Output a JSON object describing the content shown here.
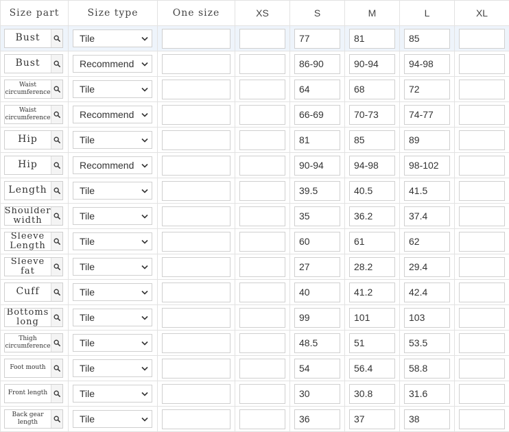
{
  "headers": {
    "part": "Size part",
    "type": "Size type",
    "one": "One size",
    "xs": "XS",
    "s": "S",
    "m": "M",
    "l": "L",
    "xl": "XL"
  },
  "rows": [
    {
      "part": "Bust",
      "type": "Tile",
      "one": "",
      "xs": "",
      "s": "77",
      "m": "81",
      "l": "85",
      "xl": ""
    },
    {
      "part": "Bust",
      "type": "Recommend",
      "one": "",
      "xs": "",
      "s": "86-90",
      "m": "90-94",
      "l": "94-98",
      "xl": ""
    },
    {
      "part": "Waist circumference",
      "type": "Tile",
      "one": "",
      "xs": "",
      "s": "64",
      "m": "68",
      "l": "72",
      "xl": ""
    },
    {
      "part": "Waist circumference",
      "type": "Recommend",
      "one": "",
      "xs": "",
      "s": "66-69",
      "m": "70-73",
      "l": "74-77",
      "xl": ""
    },
    {
      "part": "Hip",
      "type": "Tile",
      "one": "",
      "xs": "",
      "s": "81",
      "m": "85",
      "l": "89",
      "xl": ""
    },
    {
      "part": "Hip",
      "type": "Recommend",
      "one": "",
      "xs": "",
      "s": "90-94",
      "m": "94-98",
      "l": "98-102",
      "xl": ""
    },
    {
      "part": "Length",
      "type": "Tile",
      "one": "",
      "xs": "",
      "s": "39.5",
      "m": "40.5",
      "l": "41.5",
      "xl": ""
    },
    {
      "part": "Shoulder width",
      "type": "Tile",
      "one": "",
      "xs": "",
      "s": "35",
      "m": "36.2",
      "l": "37.4",
      "xl": ""
    },
    {
      "part": "Sleeve Length",
      "type": "Tile",
      "one": "",
      "xs": "",
      "s": "60",
      "m": "61",
      "l": "62",
      "xl": ""
    },
    {
      "part": "Sleeve fat",
      "type": "Tile",
      "one": "",
      "xs": "",
      "s": "27",
      "m": "28.2",
      "l": "29.4",
      "xl": ""
    },
    {
      "part": "Cuff",
      "type": "Tile",
      "one": "",
      "xs": "",
      "s": "40",
      "m": "41.2",
      "l": "42.4",
      "xl": ""
    },
    {
      "part": "Bottoms long",
      "type": "Tile",
      "one": "",
      "xs": "",
      "s": "99",
      "m": "101",
      "l": "103",
      "xl": ""
    },
    {
      "part": "Thigh circumference",
      "type": "Tile",
      "one": "",
      "xs": "",
      "s": "48.5",
      "m": "51",
      "l": "53.5",
      "xl": ""
    },
    {
      "part": "Foot mouth",
      "type": "Tile",
      "one": "",
      "xs": "",
      "s": "54",
      "m": "56.4",
      "l": "58.8",
      "xl": ""
    },
    {
      "part": "Front length",
      "type": "Tile",
      "one": "",
      "xs": "",
      "s": "30",
      "m": "30.8",
      "l": "31.6",
      "xl": ""
    },
    {
      "part": "Back gear length",
      "type": "Tile",
      "one": "",
      "xs": "",
      "s": "36",
      "m": "37",
      "l": "38",
      "xl": ""
    }
  ],
  "icons": {
    "search": "search-icon",
    "dropdown": "chevron-down-icon"
  },
  "colors": {
    "highlight_row": "#eef4fb",
    "border": "#cfcfcf"
  }
}
